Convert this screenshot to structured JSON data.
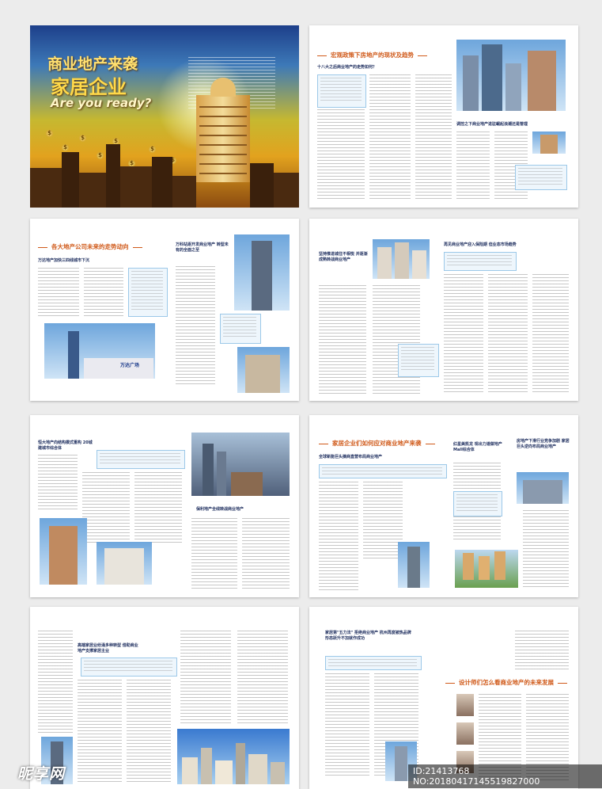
{
  "cover": {
    "line1": "商业地产来袭",
    "line2": "家居企业",
    "line3": "Are you ready?",
    "coin_symbol": "$"
  },
  "pages": {
    "p2_title": "宏观政策下房地产的现状及趋势",
    "p2_sub1": "十八大之后商业地产的走势如何？",
    "p2_sub2": "调控之下商业地产进驻崛起浪潮还是管理",
    "p3_title": "各大地产公司未来的走势动向",
    "p3_sub1": "万达地产加快三四线城市下沉",
    "p3_sub2": "万科站逐开发商业地产 转型未有的全面之至",
    "p3_banner": "万达广场",
    "p4_sub1": "坚持推进城住不相悦 并逐渐成熟转战商业地产",
    "p4_sub2": "再见商业地产迎入保险期 但业态市场趋势",
    "p5_sub1": "恒大地产向结构模式重构 20城建城市综合体",
    "p5_sub2": "保利地产全线转战商业地产",
    "p6_title": "家居企业们如何应对商业地产来袭",
    "p6_sub1": "全球新能巨头摘商直营布局商业地产",
    "p6_sub2": "红星美凯龙 现出力道做地产Mall综合体",
    "p6_sub3": "房地产下滑行业竞争加剧 家居巨头逆向布局商业地产",
    "p7_sub1": "高端家居业纷涌多种转型 借助商业地产支撑家居主业",
    "p8_sub1": "家居第\"五力法\" 拒绝商业地产 杭州再度被热品牌形态跃升不加就作成功",
    "p8_title": "设计师们怎么看商业地产的未来发展"
  },
  "watermark": {
    "logo": "昵享网",
    "text": "ID:21413768 NO:20180417145519827000"
  }
}
